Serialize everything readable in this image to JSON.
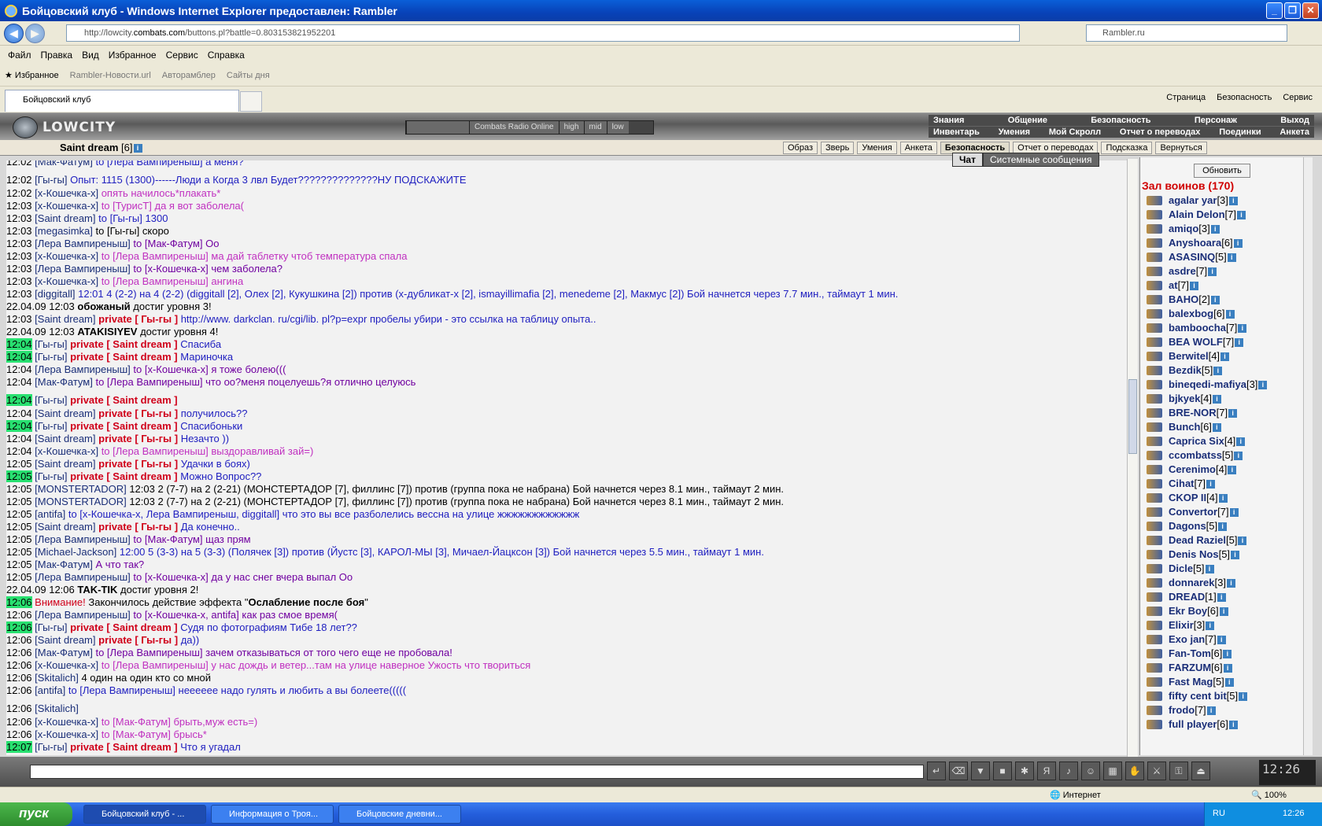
{
  "window": {
    "title": "Бойцовский клуб - Windows Internet Explorer предоставлен: Rambler"
  },
  "address": {
    "url_prefix": "http://lowcity.",
    "url_domain": "combats.com",
    "url_suffix": "/buttons.pl?battle=0.803153821952201",
    "search_placeholder": "Rambler.ru"
  },
  "menu": [
    "Файл",
    "Правка",
    "Вид",
    "Избранное",
    "Сервис",
    "Справка"
  ],
  "favbar": {
    "favorites": "Избранное",
    "items": [
      "Rambler-Новости.url",
      "Авторамблер",
      "Сайты дня"
    ]
  },
  "tab": {
    "title": "Бойцовский клуб"
  },
  "toolbar_right": [
    "Страница",
    "Безопасность",
    "Сервис"
  ],
  "game": {
    "logo": "LOWCITY",
    "radio": {
      "label": "Combats Radio Online",
      "high": "high",
      "mid": "mid",
      "low": "low"
    },
    "nav_row1": [
      "Знания",
      "Общение",
      "Безопасность",
      "Персонаж",
      "Выход"
    ],
    "nav_row2": [
      "Инвентарь",
      "Умения",
      "Мой Скролл",
      "Отчет о переводах",
      "Поединки",
      "Анкета"
    ],
    "player": {
      "name": "Saint dream",
      "level": "[6]"
    },
    "player_tabs": [
      "Образ",
      "Зверь",
      "Умения",
      "Анкета",
      "Безопасность",
      "Отчет о переводах",
      "Подсказка",
      "Вернуться"
    ],
    "chat_tabs": {
      "chat": "Чат",
      "system": "Системные сообщения"
    }
  },
  "chat": [
    {
      "t": "12:02",
      "n": "[Мак-Фатум]",
      "pre": "to [Лера Вампиреныш]",
      "m": "а меня?",
      "c": "bl"
    },
    {
      "t": "12:02",
      "n": "[Гы-гы]",
      "m": "Опыт: 1115 (1300)------Люди а Когда 3 лвл Будет??????????????НУ ПОДСКАЖИТЕ",
      "c": "bl",
      "tall": true
    },
    {
      "t": "12:02",
      "n": "[x-Кошечка-x]",
      "m": "опять начилось*плакать*",
      "c": "pk"
    },
    {
      "t": "12:03",
      "n": "[x-Кошечка-x]",
      "pre": "to [ТурисТ]",
      "m": "да я вот заболела(",
      "c": "pk"
    },
    {
      "t": "12:03",
      "n": "[Saint dream]",
      "pre": "to [Гы-гы]",
      "m": "1300",
      "c": "bl"
    },
    {
      "t": "12:03",
      "n": "[megasimka]",
      "pre": "to [Гы-гы]",
      "m": "скоро",
      "c": "t"
    },
    {
      "t": "12:03",
      "n": "[Лера Вампиреныш]",
      "pre": "to [Мак-Фатум]",
      "m": "Оо",
      "c": "pu"
    },
    {
      "t": "12:03",
      "n": "[x-Кошечка-x]",
      "pre": "to [Лера Вампиреныш]",
      "m": "ма дай таблетку чтоб температура спала",
      "c": "pk"
    },
    {
      "t": "12:03",
      "n": "[Лера Вампиреныш]",
      "pre": "to [x-Кошечка-x]",
      "m": "чем заболела?",
      "c": "pu"
    },
    {
      "t": "12:03",
      "n": "[x-Кошечка-x]",
      "pre": "to [Лера Вампиреныш]",
      "m": "ангина",
      "c": "pk"
    },
    {
      "t": "12:03",
      "n": "[diggitall]",
      "m": "12:01 4 (2-2) на 4 (2-2) (diggitall [2], Олех [2], Кукушкина [2]) против (x-дубликат-x [2], ismayillimafia [2], menedeme [2], Макмус [2]) Бой начнется через 7.7 мин., таймаут 1 мин.",
      "c": "bl"
    },
    {
      "t": "22.04.09 12:03",
      "n": "обожаный",
      "m": "достиг уровня 3!",
      "c": "t",
      "sys": true
    },
    {
      "t": "12:03",
      "n": "[Saint dream]",
      "priv": "private [ Гы-гы ]",
      "m": "http://www. darkclan. ru/cgi/lib. pl?p=expr пробелы убири - это ссылка на таблицу опыта..",
      "c": "bl"
    },
    {
      "t": "22.04.09 12:03",
      "n": "ATAKISIYEV",
      "m": "достиг уровня 4!",
      "c": "t",
      "sys": true
    },
    {
      "t": "12:04",
      "n": "[Гы-гы]",
      "priv": "private [ Saint dream ]",
      "m": "Спасиба",
      "c": "bl",
      "hl": true
    },
    {
      "t": "12:04",
      "n": "[Гы-гы]",
      "priv": "private [ Saint dream ]",
      "m": "Мариночка",
      "c": "bl",
      "hl": true
    },
    {
      "t": "12:04",
      "n": "[Лера Вампиреныш]",
      "pre": "to [x-Кошечка-x]",
      "m": "я тоже болею(((",
      "c": "pu"
    },
    {
      "t": "12:04",
      "n": "[Мак-Фатум]",
      "pre": "to [Лера Вампиреныш]",
      "m": "что оо?меня поцелуешь?я отлично целуюсь",
      "c": "pu"
    },
    {
      "t": "12:04",
      "n": "[Гы-гы]",
      "priv": "private [ Saint dream ]",
      "m": "",
      "c": "bl",
      "hl": true,
      "tall": true
    },
    {
      "t": "12:04",
      "n": "[Saint dream]",
      "priv": "private [ Гы-гы ]",
      "m": "получилось??",
      "c": "bl"
    },
    {
      "t": "12:04",
      "n": "[Гы-гы]",
      "priv": "private [ Saint dream ]",
      "m": "Спасибоньки",
      "c": "bl",
      "hl": true
    },
    {
      "t": "12:04",
      "n": "[Saint dream]",
      "priv": "private [ Гы-гы ]",
      "m": "Незачто ))",
      "c": "bl"
    },
    {
      "t": "12:04",
      "n": "[x-Кошечка-x]",
      "pre": "to [Лера Вампиреныш]",
      "m": "выздоравливай зай=)",
      "c": "pk"
    },
    {
      "t": "12:05",
      "n": "[Saint dream]",
      "priv": "private [ Гы-гы ]",
      "m": "Удачки в боях)",
      "c": "bl"
    },
    {
      "t": "12:05",
      "n": "[Гы-гы]",
      "priv": "private [ Saint dream ]",
      "m": "Можно Вопрос??",
      "c": "bl",
      "hl": true
    },
    {
      "t": "12:05",
      "n": "[MONSTERTADOR]",
      "m": "12:03 2 (7-7) на 2 (2-21) (МОНСТЕРТАДОР [7], филлинс [7]) против (группа пока не набрана) Бой начнется через 8.1 мин., таймаут 2 мин.",
      "c": "t"
    },
    {
      "t": "12:05",
      "n": "[MONSTERTADOR]",
      "m": "12:03 2 (7-7) на 2 (2-21) (МОНСТЕРТАДОР [7], филлинс [7]) против (группа пока не набрана) Бой начнется через 8.1 мин., таймаут 2 мин.",
      "c": "t"
    },
    {
      "t": "12:05",
      "n": "[antifa]",
      "pre": "to [x-Кошечка-x, Лера Вампиреныш, diggitall]",
      "m": "что это вы все разболелись вессна на улице жжжжжжжжжжжж",
      "c": "bl"
    },
    {
      "t": "12:05",
      "n": "[Saint dream]",
      "priv": "private [ Гы-гы ]",
      "m": "Да конечно..",
      "c": "bl"
    },
    {
      "t": "12:05",
      "n": "[Лера Вампиреныш]",
      "pre": "to [Мак-Фатум]",
      "m": "щаз прям",
      "c": "pu"
    },
    {
      "t": "12:05",
      "n": "[Michael-Jackson]",
      "m": "12:00 5 (3-3) на 5 (3-3) (Полячек [3]) против (Йустс [3], КАРОЛ-МЫ [3], Мичаел-Йацксон [3]) Бой начнется через 5.5 мин., таймаут 1 мин.",
      "c": "bl"
    },
    {
      "t": "12:05",
      "n": "[Мак-Фатум]",
      "m": "А что так?",
      "c": "pu"
    },
    {
      "t": "12:05",
      "n": "[Лера Вампиреныш]",
      "pre": "to [x-Кошечка-x]",
      "m": "да у нас снег вчера выпал Оо",
      "c": "pu"
    },
    {
      "t": "22.04.09 12:06",
      "n": "TAK-TIK",
      "m": "достиг уровня 2!",
      "c": "t",
      "sys": true
    },
    {
      "t": "12:06",
      "n": "",
      "warn": "Внимание!",
      "m": "Закончилось действие эффекта \"Ослабление после боя\"",
      "c": "t",
      "hl": true
    },
    {
      "t": "12:06",
      "n": "[Лера Вампиреныш]",
      "pre": "to [x-Кошечка-x, antifa]",
      "m": "как раз смое время(",
      "c": "pu"
    },
    {
      "t": "12:06",
      "n": "[Гы-гы]",
      "priv": "private [ Saint dream ]",
      "m": "Судя по фотографиям Тибе 18 лет??",
      "c": "bl",
      "hl": true
    },
    {
      "t": "12:06",
      "n": "[Saint dream]",
      "priv": "private [ Гы-гы ]",
      "m": "да))",
      "c": "bl"
    },
    {
      "t": "12:06",
      "n": "[Мак-Фатум]",
      "pre": "to [Лера Вампиреныш]",
      "m": "зачем отказываться от того чего еще не пробовала!",
      "c": "pu"
    },
    {
      "t": "12:06",
      "n": "[x-Кошечка-x]",
      "pre": "to [Лера Вампиреныш]",
      "m": "у нас дождь и ветер...там на улице наверное Ужость что твориться",
      "c": "pk"
    },
    {
      "t": "12:06",
      "n": "[Skitalich]",
      "m": "4 один на один кто со мной",
      "c": "t"
    },
    {
      "t": "12:06",
      "n": "[antifa]",
      "pre": "to [Лера Вампиреныш]",
      "m": "нееееее надо гулять и любить а вы болеете(((((",
      "c": "bl"
    },
    {
      "t": "12:06",
      "n": "[Skitalich]",
      "m": "",
      "c": "t",
      "tall": true
    },
    {
      "t": "12:06",
      "n": "[x-Кошечка-x]",
      "pre": "to [Мак-Фатум]",
      "m": "брыть,муж есть=)",
      "c": "pk"
    },
    {
      "t": "12:06",
      "n": "[x-Кошечка-x]",
      "pre": "to [Мак-Фатум]",
      "m": "брысь*",
      "c": "pk"
    },
    {
      "t": "12:07",
      "n": "[Гы-гы]",
      "priv": "private [ Saint dream ]",
      "m": "Что я угадал",
      "c": "bl",
      "hl": true
    }
  ],
  "sidebar": {
    "refresh": "Обновить",
    "hall": "Зал воинов (170)",
    "players": [
      {
        "n": "agalar yar",
        "l": "[3]"
      },
      {
        "n": "Alain Delon",
        "l": "[7]"
      },
      {
        "n": "amiqo",
        "l": "[3]"
      },
      {
        "n": "Anyshoara",
        "l": "[6]"
      },
      {
        "n": "ASASINQ",
        "l": "[5]"
      },
      {
        "n": "asdre",
        "l": "[7]"
      },
      {
        "n": "at",
        "l": "[7]"
      },
      {
        "n": "BAHO",
        "l": "[2]"
      },
      {
        "n": "balexbog",
        "l": "[6]"
      },
      {
        "n": "bamboocha",
        "l": "[7]"
      },
      {
        "n": "BEA WOLF",
        "l": "[7]"
      },
      {
        "n": "Berwitel",
        "l": "[4]"
      },
      {
        "n": "Bezdik",
        "l": "[5]"
      },
      {
        "n": "bineqedi-mafiya",
        "l": "[3]"
      },
      {
        "n": "bjkyek",
        "l": "[4]"
      },
      {
        "n": "BRE-NOR",
        "l": "[7]"
      },
      {
        "n": "Bunch",
        "l": "[6]"
      },
      {
        "n": "Caprica Six",
        "l": "[4]"
      },
      {
        "n": "ccombatss",
        "l": "[5]"
      },
      {
        "n": "Cerenimo",
        "l": "[4]"
      },
      {
        "n": "Cihat",
        "l": "[7]"
      },
      {
        "n": "CKOP II",
        "l": "[4]"
      },
      {
        "n": "Convertor",
        "l": "[7]"
      },
      {
        "n": "Dagons",
        "l": "[5]"
      },
      {
        "n": "Dead Raziel",
        "l": "[5]"
      },
      {
        "n": "Denis Nos",
        "l": "[5]"
      },
      {
        "n": "Dicle",
        "l": "[5]"
      },
      {
        "n": "donnarek",
        "l": "[3]"
      },
      {
        "n": "DREAD",
        "l": "[1]"
      },
      {
        "n": "Ekr Boy",
        "l": "[6]"
      },
      {
        "n": "Elixir",
        "l": "[3]"
      },
      {
        "n": "Exo jan",
        "l": "[7]"
      },
      {
        "n": "Fan-Tom",
        "l": "[6]"
      },
      {
        "n": "FARZUM",
        "l": "[6]"
      },
      {
        "n": "Fast Mag",
        "l": "[5]"
      },
      {
        "n": "fifty cent bit",
        "l": "[5]"
      },
      {
        "n": "frodo",
        "l": "[7]"
      },
      {
        "n": "full player",
        "l": "[6]"
      }
    ]
  },
  "clock": "12:26",
  "status": {
    "zone": "Интернет",
    "zoom": "100%"
  },
  "taskbar": {
    "start": "пуск",
    "tasks": [
      "Бойцовский клуб - ...",
      "Информация о Троя...",
      "Бойцовские дневни..."
    ],
    "lang": "RU",
    "time": "12:26"
  }
}
